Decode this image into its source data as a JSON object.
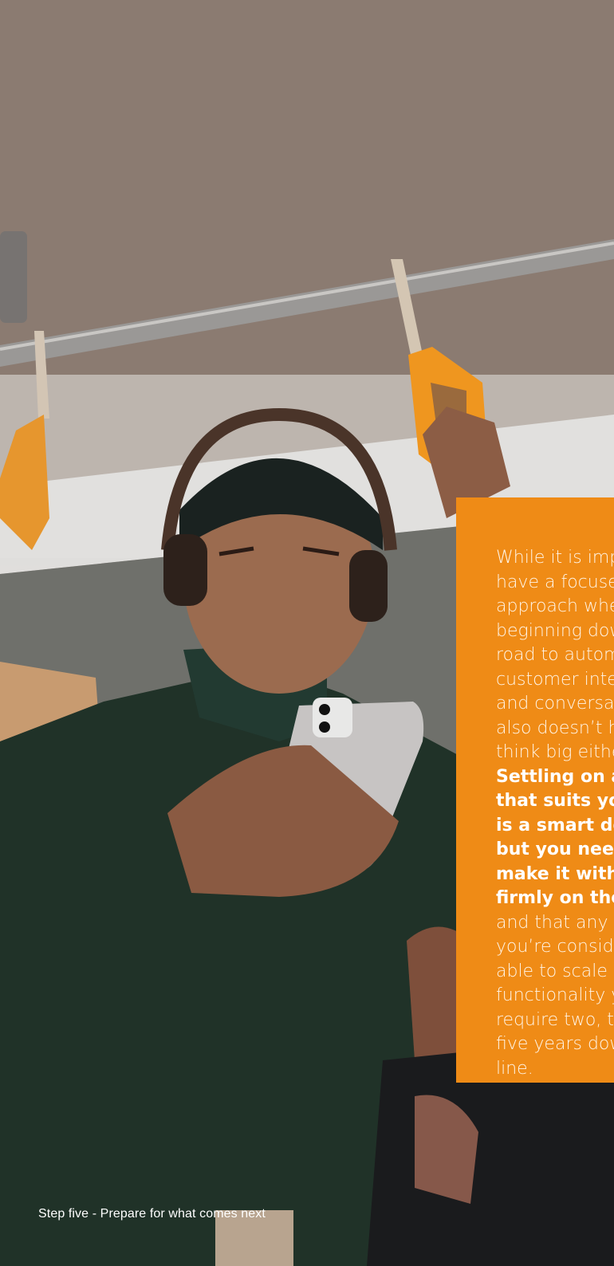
{
  "card": {
    "intro_text": "While it is important to have a focused approach when beginning down the road to automating customer interactions and conversations, it also doesn’t hurt to think big either.",
    "emphasis_text": "Settling on a tool that suits your goals is a smart decision, but you need to make it with an eye firmly on the future,",
    "closing_text": "and that any tool you’re considering is able to scale on the functionality you’ll require two, three or five years down the line."
  },
  "caption": "Step five - Prepare for what comes next",
  "colors": {
    "card_background": "#ef8b16",
    "caption_text": "#ffffff"
  }
}
